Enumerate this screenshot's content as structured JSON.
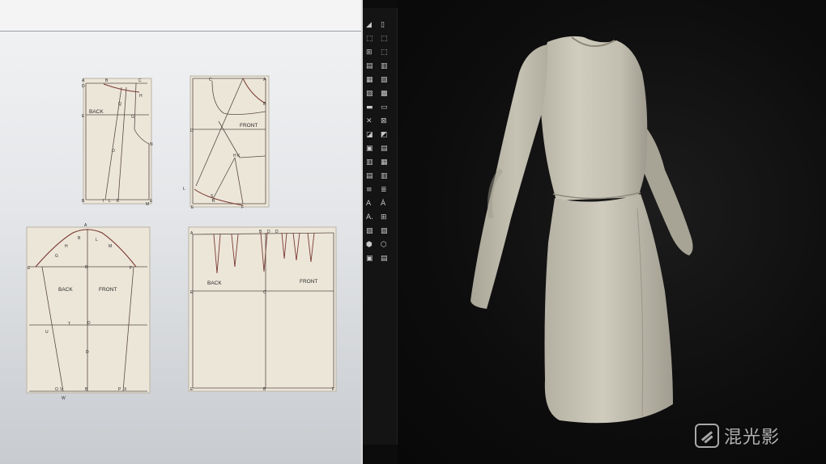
{
  "patterns": {
    "bodice_back": {
      "label": "BACK",
      "points": [
        "A",
        "D",
        "C",
        "B",
        "H",
        "E",
        "G",
        "Q",
        "O",
        "N",
        "B",
        "I",
        "L",
        "K",
        "E",
        "M"
      ]
    },
    "bodice_front": {
      "label": "FRONT",
      "points": [
        "C",
        "A",
        "B",
        "D",
        "H",
        "K",
        "L",
        "S",
        "R",
        "E",
        "F"
      ]
    },
    "sleeve": {
      "back_label": "BACK",
      "front_label": "FRONT",
      "points": [
        "A",
        "B",
        "H",
        "G",
        "L",
        "M",
        "F",
        "E",
        "T",
        "D",
        "U",
        "O",
        "V",
        "W",
        "P",
        "X",
        "B",
        "D",
        "B"
      ]
    },
    "skirt": {
      "back_label": "BACK",
      "front_label": "FRONT",
      "points": [
        "A",
        "B",
        "D",
        "E",
        "C",
        "E",
        "B",
        "D",
        "F"
      ]
    }
  },
  "toolbar": {
    "tools": [
      {
        "a": "◢",
        "b": "▯"
      },
      {
        "a": "⬚",
        "b": "⬚"
      },
      {
        "a": "⊞",
        "b": "⬚"
      },
      {
        "a": "▤",
        "b": "▥"
      },
      {
        "a": "▦",
        "b": "▧"
      },
      {
        "a": "▨",
        "b": "▩"
      },
      {
        "a": "▬",
        "b": "▭"
      },
      {
        "a": "✕",
        "b": "⊠"
      },
      {
        "a": "◪",
        "b": "◩"
      },
      {
        "a": "▣",
        "b": "▤"
      },
      {
        "a": "▥",
        "b": "▦"
      },
      {
        "a": "▤",
        "b": "▥"
      },
      {
        "a": "≡",
        "b": "≣"
      },
      {
        "a": "A",
        "b": "Ȧ"
      },
      {
        "a": "A.",
        "b": "⊞"
      },
      {
        "a": "▧",
        "b": "▨"
      },
      {
        "a": "⬢",
        "b": "⬡"
      },
      {
        "a": "▣",
        "b": "▤"
      }
    ]
  },
  "watermark": {
    "text": "混光影"
  },
  "colors": {
    "paper": "#ece6d9",
    "ink": "#7a3a32",
    "garment": "#c9c5b7",
    "viewport": "#0d0d0d"
  }
}
